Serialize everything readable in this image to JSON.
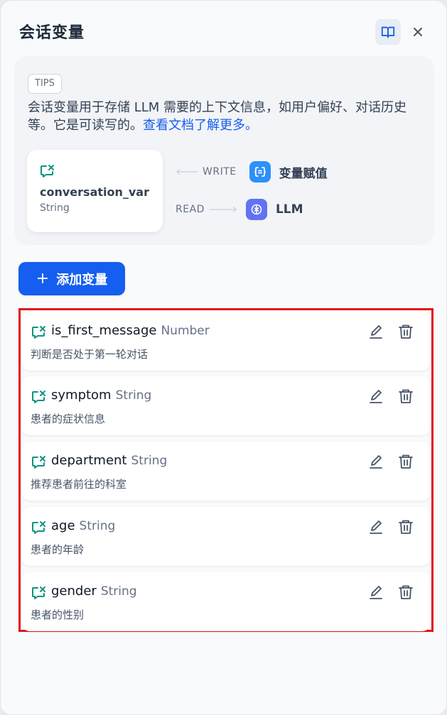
{
  "header": {
    "title": "会话变量"
  },
  "tips": {
    "badge": "TIPS",
    "text": "会话变量用于存储 LLM 需要的上下文信息，如用户偏好、对话历史等。它是可读写的。",
    "link": "查看文档了解更多。"
  },
  "example_card": {
    "name": "conversation_var",
    "type": "String"
  },
  "flow": {
    "write_label": "WRITE",
    "write_node": "变量赋值",
    "read_label": "READ",
    "read_node": "LLM"
  },
  "add_button": {
    "plus": "+",
    "label": "添加变量"
  },
  "colors": {
    "accent": "#155eef",
    "highlight_border": "#e1141b",
    "var_icon": "#0e9384"
  },
  "variables": [
    {
      "name": "is_first_message",
      "type": "Number",
      "description": "判断是否处于第一轮对话"
    },
    {
      "name": "symptom",
      "type": "String",
      "description": "患者的症状信息"
    },
    {
      "name": "department",
      "type": "String",
      "description": "推荐患者前往的科室"
    },
    {
      "name": "age",
      "type": "String",
      "description": "患者的年龄"
    },
    {
      "name": "gender",
      "type": "String",
      "description": "患者的性别"
    }
  ]
}
